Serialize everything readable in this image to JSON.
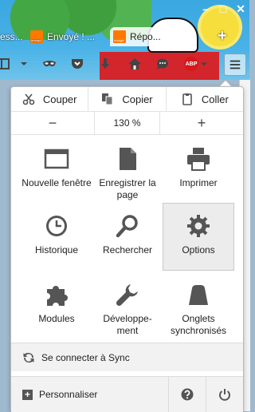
{
  "tabs": [
    {
      "title": "ess...",
      "active": false
    },
    {
      "title": "Envoyé ! ...",
      "active": false
    },
    {
      "title": "Répo...",
      "active": true
    }
  ],
  "favicon_text": "orange",
  "window_controls": {
    "minimize": "–",
    "maximize": "□",
    "close": "✕"
  },
  "new_tab_symbol": "+",
  "toolbar": {
    "adblock_label": "ABP"
  },
  "edit": {
    "cut": "Couper",
    "copy": "Copier",
    "paste": "Coller"
  },
  "zoom": {
    "out": "−",
    "level": "130 %",
    "in": "+"
  },
  "items": [
    {
      "label": "Nouvelle fenêtre",
      "icon": "new-window-icon"
    },
    {
      "label": "Enregistrer la page",
      "icon": "save-page-icon"
    },
    {
      "label": "Imprimer",
      "icon": "print-icon"
    },
    {
      "label": "Historique",
      "icon": "history-icon"
    },
    {
      "label": "Rechercher",
      "icon": "search-icon"
    },
    {
      "label": "Options",
      "icon": "gear-icon"
    },
    {
      "label": "Modules",
      "icon": "puzzle-icon"
    },
    {
      "label": "Développe-ment",
      "icon": "wrench-icon"
    },
    {
      "label": "Onglets synchronisés",
      "icon": "synced-tabs-icon"
    }
  ],
  "sync": {
    "label": "Se connecter à Sync"
  },
  "footer": {
    "customize": "Personnaliser"
  },
  "colors": {
    "accent_favicon": "#ff7900",
    "icon_gray": "#555555",
    "selected_bg": "#ececec"
  }
}
